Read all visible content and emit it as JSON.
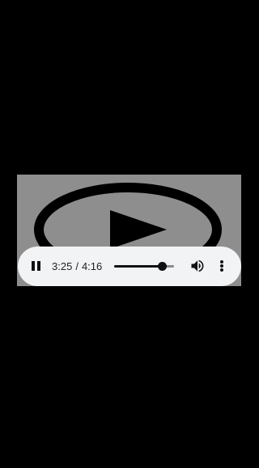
{
  "player": {
    "current_time": "3:25",
    "separator": "/",
    "duration": "4:16",
    "progress_fraction": 0.8,
    "play_state": "playing",
    "pause_icon": "pause-icon",
    "volume_icon": "volume-up-icon",
    "more_icon": "more-vert-icon",
    "poster_icon": "play-circle-icon"
  },
  "colors": {
    "page_background": "#000000",
    "poster_background": "#8e8e8e",
    "poster_art": "#000000",
    "controls_background": "#f1f3f4",
    "control_foreground": "#111111",
    "track_background": "#8a8a8a"
  }
}
